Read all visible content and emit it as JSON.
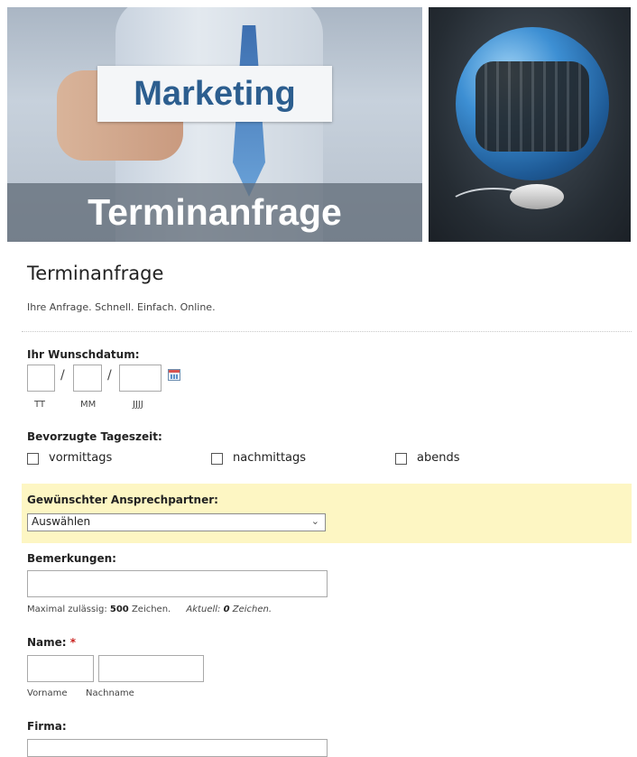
{
  "banner": {
    "card_text": "Marketing",
    "band_text": "Terminanfrage"
  },
  "form": {
    "title": "Terminanfrage",
    "subtitle": "Ihre Anfrage. Schnell. Einfach. Online."
  },
  "wunschdatum": {
    "label": "Ihr Wunschdatum:",
    "separator": "/",
    "day_sub": "TT",
    "month_sub": "MM",
    "year_sub": "JJJJ",
    "calendar_icon": "calendar-icon"
  },
  "tageszeit": {
    "label": "Bevorzugte Tageszeit:",
    "options": [
      "vormittags",
      "nachmittags",
      "abends"
    ]
  },
  "ansprechpartner": {
    "label": "Gewünschter Ansprechpartner:",
    "selected": "Auswählen",
    "highlight_color": "#fdf6c3"
  },
  "bemerkungen": {
    "label": "Bemerkungen:",
    "max_text": "Maximal zulässig:",
    "max_value": "500",
    "max_unit": "Zeichen.",
    "current_text": "Aktuell:",
    "current_value": "0",
    "current_unit": "Zeichen."
  },
  "name": {
    "label": "Name:",
    "required_mark": "*",
    "first_sub": "Vorname",
    "last_sub": "Nachname"
  },
  "firma": {
    "label": "Firma:"
  }
}
